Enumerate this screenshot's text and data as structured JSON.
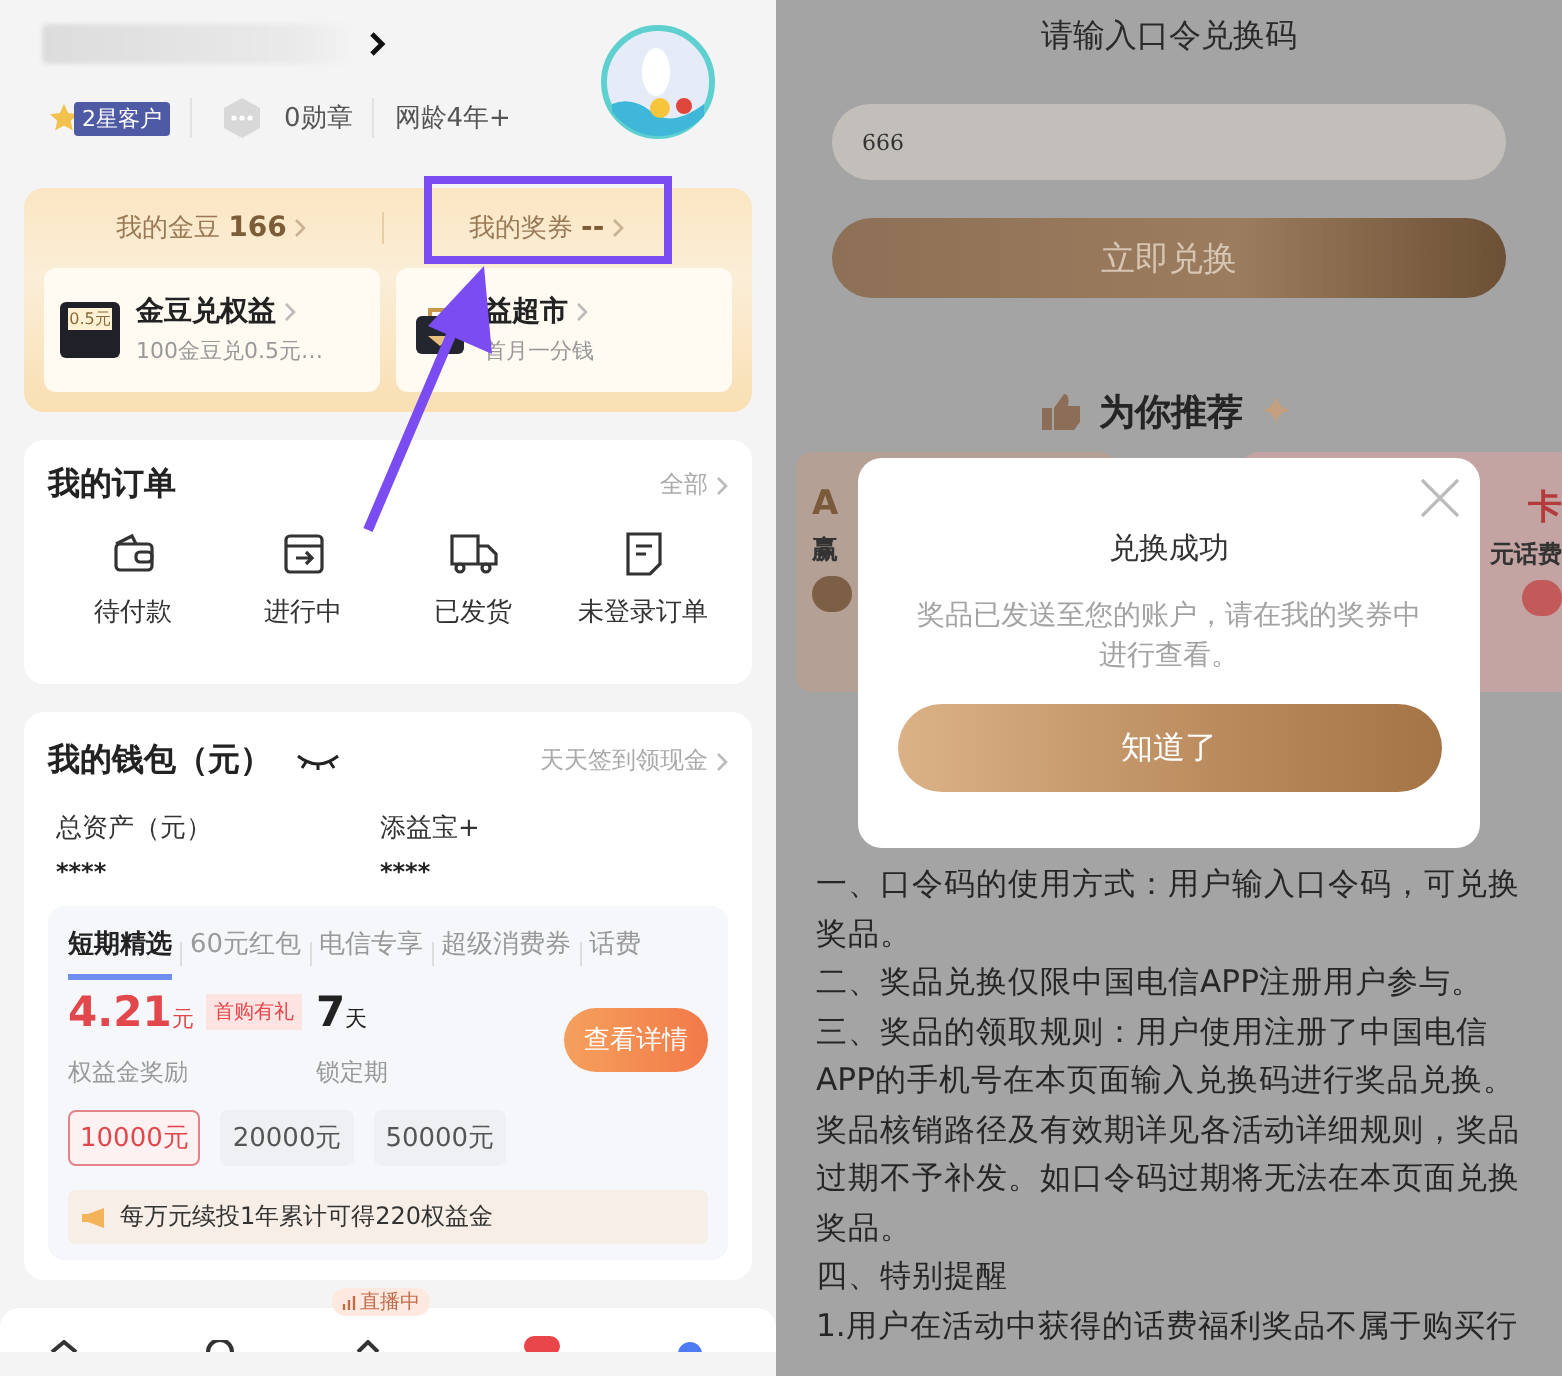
{
  "left": {
    "profile": {
      "level_badge": "2星客户",
      "medals": "0勋章",
      "net_age": "网龄4年+"
    },
    "assets": {
      "beans_label": "我的金豆",
      "beans_value": "166",
      "coupons_label": "我的奖券",
      "coupons_value": "--",
      "tiles": [
        {
          "kind": "beans",
          "title": "金豆兑权益",
          "subtitle": "100金豆兑0.5元…",
          "icon_text": "0.5元"
        },
        {
          "kind": "bag",
          "title": "益超市",
          "subtitle": "首月一分钱"
        }
      ]
    },
    "orders": {
      "title": "我的订单",
      "more": "全部",
      "items": [
        {
          "kind": "wallet",
          "label": "待付款"
        },
        {
          "kind": "box",
          "label": "进行中"
        },
        {
          "kind": "truck",
          "label": "已发货"
        },
        {
          "kind": "doc",
          "label": "未登录订单"
        }
      ]
    },
    "wallet": {
      "title": "我的钱包（元）",
      "promo": "天天签到领现金",
      "stats": [
        {
          "label": "总资产（元）",
          "value": "****"
        },
        {
          "label": "添益宝+",
          "value": "****"
        }
      ],
      "product_tabs": [
        {
          "label": "短期精选",
          "selected": true
        },
        {
          "label": "60元红包",
          "selected": false
        },
        {
          "label": "电信专享",
          "selected": false
        },
        {
          "label": "超级消费券",
          "selected": false
        },
        {
          "label": "话费",
          "selected": false
        }
      ],
      "reward": "4.21",
      "reward_unit": "元",
      "tag": "首购有礼",
      "lock": "7",
      "lock_unit": "天",
      "reward_label": "权益金奖励",
      "lock_label": "锁定期",
      "detail_button": "查看详情",
      "amounts": [
        {
          "label": "10000元",
          "selected": true
        },
        {
          "label": "20000元",
          "selected": false
        },
        {
          "label": "50000元",
          "selected": false
        }
      ],
      "tip": "每万元续投1年累计可得220权益金"
    },
    "nav": {
      "live_badge": "直播中"
    }
  },
  "right": {
    "title": "请输入口令兑换码",
    "code": "666",
    "redeem_button": "立即兑换",
    "section_title": "为你推荐",
    "cards": [
      {
        "heading": "A",
        "line": "赢"
      },
      {
        "heading": "卡",
        "line": "元话费"
      }
    ],
    "modal": {
      "title": "兑换成功",
      "message": "奖品已发送至您的账户，请在我的奖券中进行查看。",
      "button": "知道了"
    },
    "rules": [
      "一、口令码的使用方式：用户输入口令码，可兑换奖品。",
      "二、奖品兑换仅限中国电信APP注册用户参与。",
      "三、奖品的领取规则：用户使用注册了中国电信APP的手机号在本页面输入兑换码进行奖品兑换。奖品核销路径及有效期详见各活动详细规则，奖品过期不予补发。如口令码过期将无法在本页面兑换奖品。",
      "四、特别提醒",
      "1.用户在活动中获得的话费福利奖品不属于购买行"
    ]
  }
}
